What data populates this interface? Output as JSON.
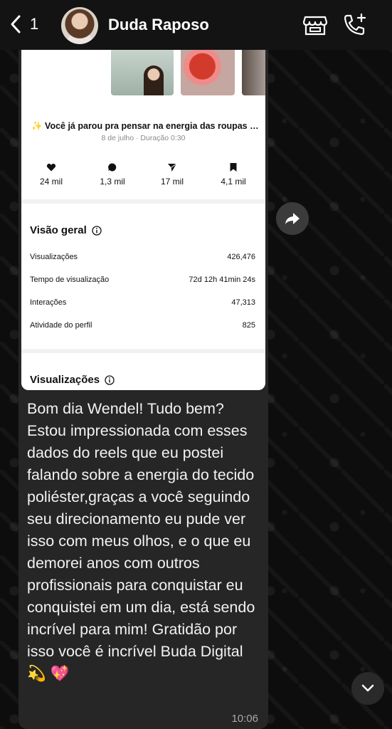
{
  "header": {
    "back_count": "1",
    "contact_name": "Duda Raposo"
  },
  "card": {
    "reel_title": "✨ Você já parou pra pensar na energia das roupas qu...",
    "reel_meta": "8 de julho · Duração 0:30",
    "stats": {
      "likes": "24 mil",
      "comments": "1,3 mil",
      "shares": "17 mil",
      "saves": "4,1 mil"
    },
    "overview": {
      "title": "Visão geral",
      "rows": [
        {
          "label": "Visualizações",
          "value": "426,476"
        },
        {
          "label": "Tempo de visualização",
          "value": "72d 12h 41min 24s"
        },
        {
          "label": "Interações",
          "value": "47,313"
        },
        {
          "label": "Atividade do perfil",
          "value": "825"
        }
      ]
    },
    "views_title": "Visualizações"
  },
  "message": {
    "text": "Bom dia Wendel! Tudo bem? Estou impressionada com esses dados do reels que eu postei falando sobre a energia do tecido poliéster,graças a você seguindo seu direcionamento eu pude ver isso com meus olhos, e o que eu demorei anos com outros profissionais para conquistar eu conquistei em um dia, está sendo incrível para mim! Gratidão por isso você é incrível Buda Digital",
    "emoji_1": "💫",
    "emoji_2": "💖",
    "time": "10:06"
  },
  "colors": {
    "header_bg": "#131313",
    "bubble_bg": "#262626",
    "card_bg": "#ffffff"
  },
  "icons": [
    "chevron-left-icon",
    "store-icon",
    "call-add-icon",
    "heart-icon",
    "comment-icon",
    "share-icon",
    "bookmark-icon",
    "info-icon",
    "forward-icon",
    "chevron-down-icon"
  ]
}
